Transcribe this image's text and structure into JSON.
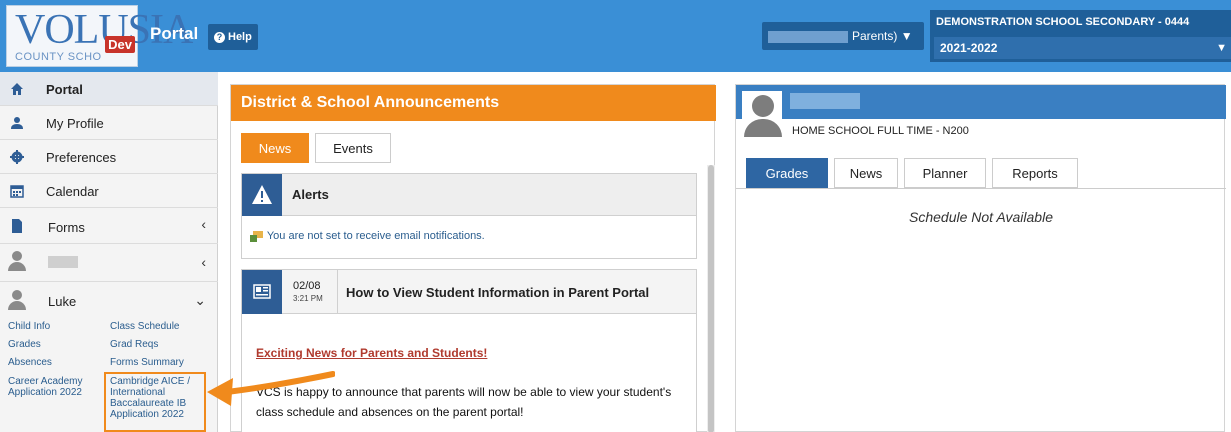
{
  "header": {
    "logo_text": "VOLUSIA",
    "logo_subtext": "COUNTY SCHO",
    "logo_badge": "Dev",
    "portal_title": "Portal",
    "help_label": "Help",
    "user_role": "Parents)",
    "school_name": "DEMONSTRATION SCHOOL SECONDARY - 0444",
    "school_year": "2021-2022"
  },
  "sidebar": {
    "items": [
      {
        "label": "Portal"
      },
      {
        "label": "My Profile"
      },
      {
        "label": "Preferences"
      },
      {
        "label": "Calendar"
      },
      {
        "label": "Forms"
      }
    ],
    "student_name": "Luke",
    "student_links": {
      "child_info": "Child Info",
      "class_schedule": "Class Schedule",
      "grades": "Grades",
      "grad_reqs": "Grad Reqs",
      "absences": "Absences",
      "forms_summary": "Forms Summary",
      "career_academy_1": "Career Academy",
      "career_academy_2": "Application 2022",
      "cambridge_1": "Cambridge AICE /",
      "cambridge_2": "International",
      "cambridge_3": "Baccalaureate IB",
      "cambridge_4": "Application 2022"
    }
  },
  "announcements": {
    "title": "District & School Announcements",
    "tabs": [
      "News",
      "Events"
    ],
    "alerts_title": "Alerts",
    "alerts_message": "You are not set to receive email notifications.",
    "news": {
      "date": "02/08",
      "time": "3:21 PM",
      "title": "How to View Student Information in Parent Portal",
      "link": "Exciting News for Parents and Students!",
      "text": "VCS is happy to announce that parents will now be able to view your student's class schedule and absences on the parent portal!"
    }
  },
  "student_panel": {
    "school": "HOME SCHOOL FULL TIME - N200",
    "tabs": [
      "Grades",
      "News",
      "Planner",
      "Reports"
    ],
    "schedule_message": "Schedule Not Available"
  },
  "colors": {
    "header_blue": "#3a8fd6",
    "orange": "#f08a1c",
    "dark_blue": "#2e5d95"
  }
}
